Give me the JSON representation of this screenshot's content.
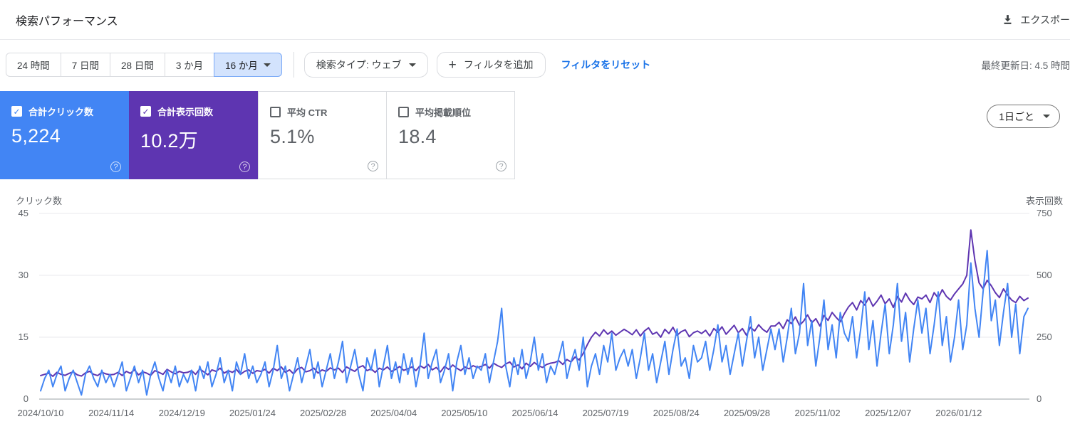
{
  "header": {
    "title": "検索パフォーマンス",
    "export_label": "エクスポー"
  },
  "filters": {
    "date_ranges": [
      {
        "label": "24 時間",
        "selected": false
      },
      {
        "label": "7 日間",
        "selected": false
      },
      {
        "label": "28 日間",
        "selected": false
      },
      {
        "label": "3 か月",
        "selected": false
      },
      {
        "label": "16 か月",
        "selected": true
      }
    ],
    "search_type_label": "検索タイプ: ウェブ",
    "add_filter_label": "フィルタを追加",
    "reset_filters_label": "フィルタをリセット",
    "last_updated": "最終更新日: 4.5 時間"
  },
  "metrics": {
    "cards": [
      {
        "label": "合計クリック数",
        "value": "5,224",
        "checked": true,
        "color": "#4285f4"
      },
      {
        "label": "合計表示回数",
        "value": "10.2万",
        "checked": true,
        "color": "#5e35b1"
      },
      {
        "label": "平均 CTR",
        "value": "5.1%",
        "checked": false,
        "color": ""
      },
      {
        "label": "平均掲載順位",
        "value": "18.4",
        "checked": false,
        "color": ""
      }
    ]
  },
  "granularity": {
    "label": "1日ごと"
  },
  "chart_data": {
    "type": "line",
    "grid": true,
    "left_axis": {
      "label": "クリック数",
      "ticks": [
        0,
        15,
        30,
        45
      ],
      "ylim": [
        0,
        45
      ]
    },
    "right_axis": {
      "label": "表示回数",
      "ticks": [
        0,
        250,
        500,
        750
      ],
      "ylim": [
        0,
        750
      ]
    },
    "x_tick_labels": [
      "2024/10/10",
      "2024/11/14",
      "2024/12/19",
      "2025/01/24",
      "2025/02/28",
      "2025/04/04",
      "2025/05/10",
      "2025/06/14",
      "2025/07/19",
      "2025/08/24",
      "2025/09/28",
      "2025/11/02",
      "2025/12/07",
      "2026/01/12"
    ],
    "x_note": "daily series 2024/10/10 - 2026/02 downsampled to every 2 days",
    "series": [
      {
        "name": "合計表示回数",
        "axis": "right",
        "color": "#5e35b1",
        "values": [
          95,
          100,
          105,
          92,
          108,
          100,
          96,
          104,
          110,
          98,
          93,
          106,
          112,
          100,
          95,
          108,
          102,
          98,
          100,
          108,
          95,
          112,
          104,
          118,
          98,
          110,
          105,
          96,
          115,
          108,
          100,
          120,
          110,
          102,
          112,
          106,
          108,
          115,
          100,
          122,
          110,
          98,
          118,
          112,
          125,
          105,
          115,
          108,
          120,
          100,
          112,
          118,
          104,
          115,
          112,
          120,
          105,
          125,
          115,
          130,
          108,
          118,
          102,
          122,
          128,
          110,
          115,
          125,
          105,
          118,
          112,
          126,
          118,
          125,
          108,
          130,
          120,
          112,
          128,
          135,
          115,
          122,
          108,
          125,
          118,
          130,
          112,
          120,
          132,
          116,
          122,
          130,
          115,
          135,
          125,
          140,
          118,
          128,
          110,
          132,
          120,
          138,
          125,
          115,
          130,
          122,
          135,
          128,
          132,
          140,
          125,
          145,
          135,
          128,
          142,
          150,
          130,
          138,
          122,
          145,
          132,
          148,
          135,
          128,
          140,
          145,
          148,
          155,
          140,
          160,
          150,
          170,
          158,
          185,
          220,
          250,
          270,
          255,
          280,
          262,
          275,
          258,
          270,
          282,
          272,
          260,
          280,
          255,
          275,
          288,
          262,
          270,
          250,
          282,
          265,
          290,
          258,
          272,
          280,
          252,
          268,
          275,
          265,
          278,
          255,
          285,
          270,
          292,
          262,
          280,
          298,
          268,
          285,
          258,
          290,
          275,
          300,
          282,
          270,
          295,
          295,
          310,
          285,
          320,
          305,
          332,
          298,
          315,
          340,
          308,
          325,
          295,
          338,
          318,
          350,
          330,
          312,
          345,
          372,
          390,
          360,
          398,
          380,
          410,
          375,
          395,
          420,
          385,
          405,
          370,
          415,
          392,
          428,
          400,
          382,
          412,
          405,
          420,
          390,
          430,
          408,
          442,
          415,
          400,
          425,
          445,
          465,
          500,
          683,
          560,
          470,
          445,
          480,
          458,
          430,
          410,
          445,
          420,
          400,
          390,
          415,
          398,
          408
        ]
      },
      {
        "name": "合計クリック数",
        "axis": "left",
        "color": "#4285f4",
        "values": [
          2,
          5,
          7,
          3,
          6,
          8,
          2,
          5,
          7,
          4,
          1,
          6,
          8,
          5,
          3,
          7,
          4,
          6,
          3,
          6,
          9,
          2,
          5,
          8,
          4,
          7,
          1,
          6,
          9,
          5,
          2,
          7,
          4,
          8,
          3,
          6,
          4,
          7,
          2,
          8,
          5,
          9,
          3,
          6,
          10,
          4,
          7,
          2,
          9,
          6,
          11,
          5,
          8,
          4,
          6,
          9,
          3,
          7,
          13,
          5,
          8,
          2,
          6,
          10,
          4,
          8,
          12,
          5,
          9,
          3,
          7,
          11,
          5,
          9,
          14,
          4,
          8,
          12,
          6,
          2,
          10,
          7,
          12,
          3,
          8,
          13,
          5,
          9,
          4,
          11,
          6,
          10,
          3,
          8,
          16,
          5,
          9,
          12,
          4,
          7,
          11,
          2,
          9,
          13,
          6,
          10,
          5,
          8,
          7,
          11,
          4,
          9,
          14,
          22,
          8,
          3,
          10,
          6,
          12,
          5,
          9,
          15,
          7,
          11,
          4,
          8,
          6,
          10,
          14,
          5,
          9,
          12,
          7,
          15,
          3,
          8,
          11,
          6,
          13,
          9,
          16,
          7,
          10,
          12,
          8,
          12,
          5,
          10,
          16,
          7,
          11,
          4,
          9,
          14,
          6,
          12,
          17,
          8,
          10,
          5,
          13,
          9,
          10,
          14,
          7,
          12,
          18,
          9,
          13,
          6,
          11,
          16,
          8,
          14,
          20,
          10,
          15,
          7,
          12,
          17,
          12,
          17,
          9,
          15,
          22,
          11,
          16,
          28,
          13,
          19,
          8,
          15,
          24,
          12,
          18,
          10,
          21,
          16,
          14,
          20,
          10,
          17,
          26,
          12,
          19,
          8,
          16,
          23,
          11,
          18,
          28,
          14,
          21,
          9,
          17,
          24,
          16,
          22,
          11,
          18,
          26,
          13,
          20,
          9,
          15,
          24,
          12,
          18,
          33,
          22,
          15,
          26,
          36,
          19,
          24,
          13,
          21,
          28,
          15,
          23,
          11,
          20,
          22
        ]
      }
    ]
  }
}
